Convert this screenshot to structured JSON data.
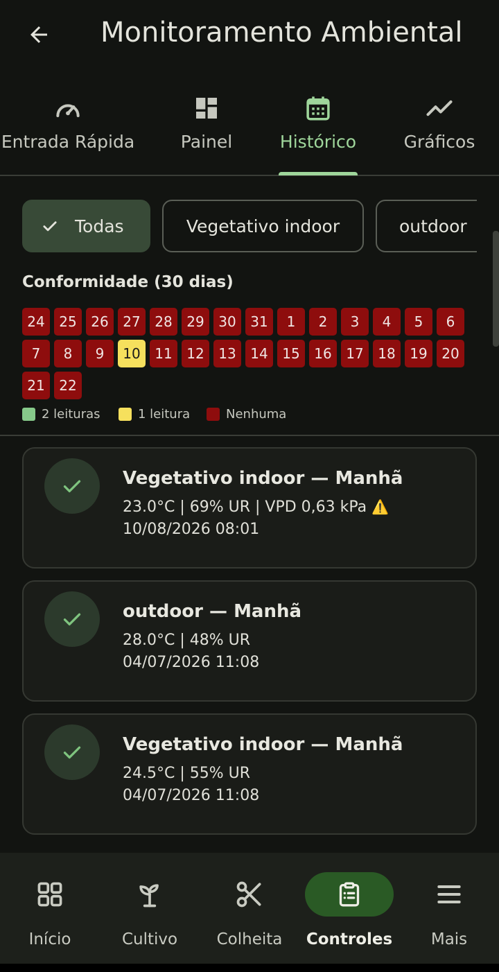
{
  "app_bar": {
    "title": "Monitoramento Ambiental"
  },
  "tabs": [
    {
      "label": "Entrada Rápida",
      "icon": "speedometer-icon"
    },
    {
      "label": "Painel",
      "icon": "dashboard-icon"
    },
    {
      "label": "Histórico",
      "icon": "calendar-icon",
      "active": true
    },
    {
      "label": "Gráficos",
      "icon": "trending-up-icon"
    }
  ],
  "filters": [
    {
      "label": "Todas",
      "selected": true
    },
    {
      "label": "Vegetativo indoor"
    },
    {
      "label": "outdoor"
    }
  ],
  "compliance": {
    "title": "Conformidade (30 dias)",
    "days": [
      {
        "day": "24",
        "status": "none"
      },
      {
        "day": "25",
        "status": "none"
      },
      {
        "day": "26",
        "status": "none"
      },
      {
        "day": "27",
        "status": "none"
      },
      {
        "day": "28",
        "status": "none"
      },
      {
        "day": "29",
        "status": "none"
      },
      {
        "day": "30",
        "status": "none"
      },
      {
        "day": "31",
        "status": "none"
      },
      {
        "day": "1",
        "status": "none"
      },
      {
        "day": "2",
        "status": "none"
      },
      {
        "day": "3",
        "status": "none"
      },
      {
        "day": "4",
        "status": "none"
      },
      {
        "day": "5",
        "status": "none"
      },
      {
        "day": "6",
        "status": "none"
      },
      {
        "day": "7",
        "status": "none"
      },
      {
        "day": "8",
        "status": "none"
      },
      {
        "day": "9",
        "status": "none"
      },
      {
        "day": "10",
        "status": "one"
      },
      {
        "day": "11",
        "status": "none"
      },
      {
        "day": "12",
        "status": "none"
      },
      {
        "day": "13",
        "status": "none"
      },
      {
        "day": "14",
        "status": "none"
      },
      {
        "day": "15",
        "status": "none"
      },
      {
        "day": "16",
        "status": "none"
      },
      {
        "day": "17",
        "status": "none"
      },
      {
        "day": "18",
        "status": "none"
      },
      {
        "day": "19",
        "status": "none"
      },
      {
        "day": "20",
        "status": "none"
      },
      {
        "day": "21",
        "status": "none"
      },
      {
        "day": "22",
        "status": "none"
      }
    ],
    "legend": [
      {
        "label": "2 leituras",
        "color": "#86c98a"
      },
      {
        "label": "1 leitura",
        "color": "#f6e05d"
      },
      {
        "label": "Nenhuma",
        "color": "#8e0d0d"
      }
    ]
  },
  "readings": [
    {
      "title": "Vegetativo indoor — Manhã",
      "values": "23.0°C | 69% UR | VPD 0,63 kPa",
      "warning": "⚠️",
      "datetime": "10/08/2026 08:01",
      "icon": "check-icon"
    },
    {
      "title": "outdoor — Manhã",
      "values": "28.0°C | 48% UR",
      "datetime": "04/07/2026 11:08",
      "icon": "check-icon"
    },
    {
      "title": "Vegetativo indoor — Manhã",
      "values": "24.5°C | 55% UR",
      "datetime": "04/07/2026 11:08",
      "icon": "check-icon"
    }
  ],
  "bottom_nav": [
    {
      "label": "Início",
      "icon": "grid-icon"
    },
    {
      "label": "Cultivo",
      "icon": "sprout-icon"
    },
    {
      "label": "Colheita",
      "icon": "scissors-icon"
    },
    {
      "label": "Controles",
      "icon": "clipboard-icon",
      "active": true
    },
    {
      "label": "Mais",
      "icon": "menu-icon"
    }
  ],
  "colors": {
    "accent": "#9fd69b",
    "none": "#8e0d0d",
    "one": "#f6e05d",
    "selected_chip": "#384a37",
    "nav_active": "#2a5a25"
  }
}
